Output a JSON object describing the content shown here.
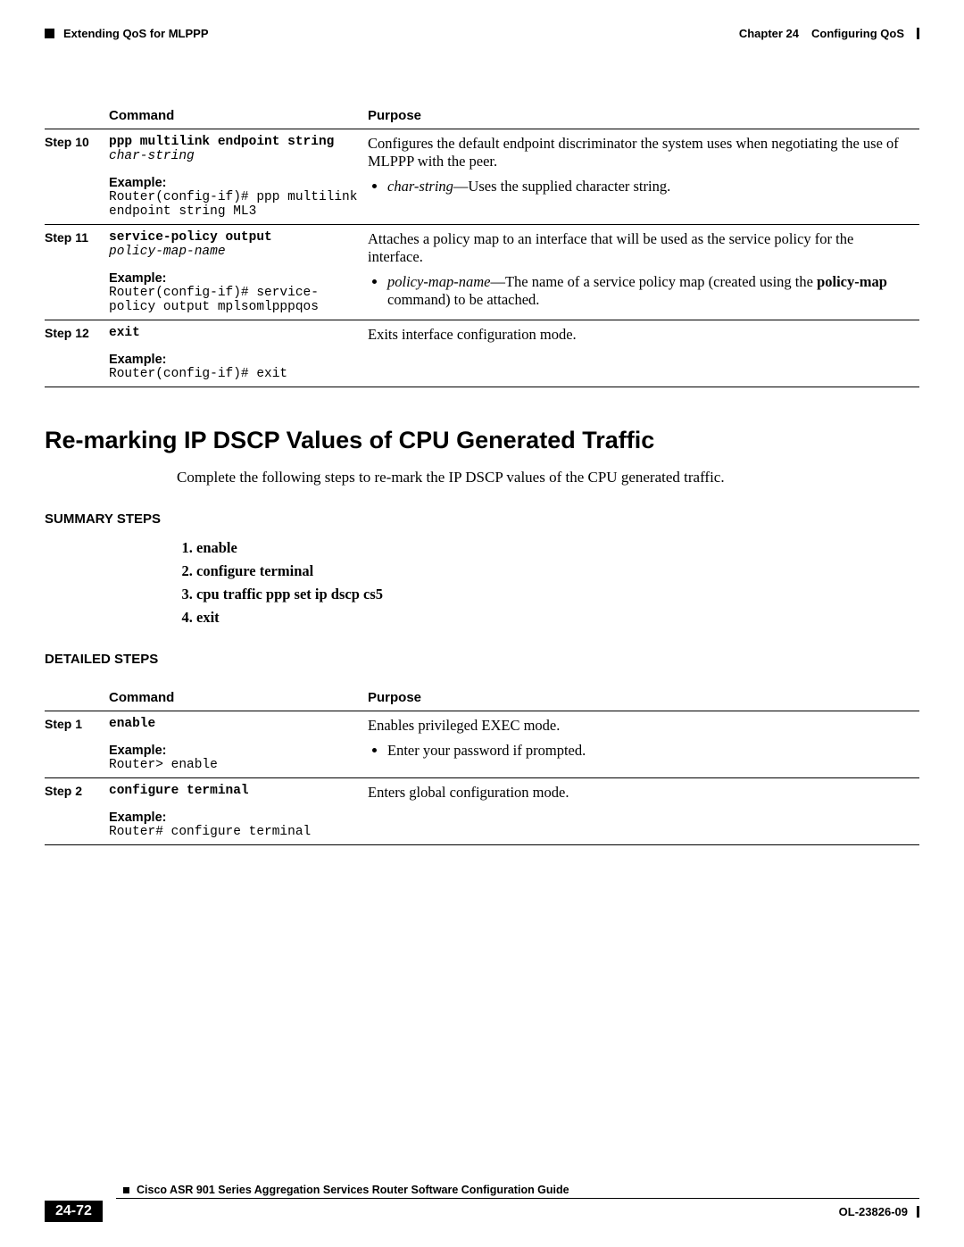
{
  "header": {
    "section_left": "Extending QoS for MLPPP",
    "chapter_label": "Chapter 24",
    "chapter_title": "Configuring QoS"
  },
  "table1": {
    "head_command": "Command",
    "head_purpose": "Purpose",
    "rows": [
      {
        "step": "Step 10",
        "cmd_bold": "ppp multilink endpoint string",
        "cmd_ital": "char-string",
        "example_label": "Example:",
        "example_text": "Router(config-if)# ppp multilink endpoint string ML3",
        "purpose_text": "Configures the default endpoint discriminator the system uses when negotiating the use of MLPPP with the peer.",
        "bullet_ital": "char-string",
        "bullet_rest": "—Uses the supplied character string."
      },
      {
        "step": "Step 11",
        "cmd_bold": "service-policy output",
        "cmd_ital": "policy-map-name",
        "example_label": "Example:",
        "example_text": "Router(config-if)# service-policy output mplsomlpppqos",
        "purpose_text": "Attaches a policy map to an interface that will be used as the service policy for the interface.",
        "bullet_ital": "policy-map-name",
        "bullet_rest_a": "—The name of a service policy map (created using the ",
        "bullet_bold": "policy-map",
        "bullet_rest_b": " command) to be attached."
      },
      {
        "step": "Step 12",
        "cmd_bold": "exit",
        "example_label": "Example:",
        "example_text": "Router(config-if)# exit",
        "purpose_text": "Exits interface configuration mode."
      }
    ]
  },
  "section_heading": "Re-marking IP DSCP Values of CPU Generated Traffic",
  "intro_text": "Complete the following steps to re-mark the IP DSCP values of the CPU generated traffic.",
  "summary_label": "SUMMARY STEPS",
  "summary_steps": [
    "enable",
    "configure terminal",
    "cpu traffic ppp set ip dscp cs5",
    "exit"
  ],
  "detailed_label": "DETAILED STEPS",
  "table2": {
    "head_command": "Command",
    "head_purpose": "Purpose",
    "rows": [
      {
        "step": "Step 1",
        "cmd_bold": "enable",
        "example_label": "Example:",
        "example_text": "Router> enable",
        "purpose_text": "Enables privileged EXEC mode.",
        "bullet": "Enter your password if prompted."
      },
      {
        "step": "Step 2",
        "cmd_bold": "configure terminal",
        "example_label": "Example:",
        "example_text": "Router# configure terminal",
        "purpose_text": "Enters global configuration mode."
      }
    ]
  },
  "footer": {
    "guide_title": "Cisco ASR 901 Series Aggregation Services Router Software Configuration Guide",
    "page_number": "24-72",
    "doc_number": "OL-23826-09"
  }
}
